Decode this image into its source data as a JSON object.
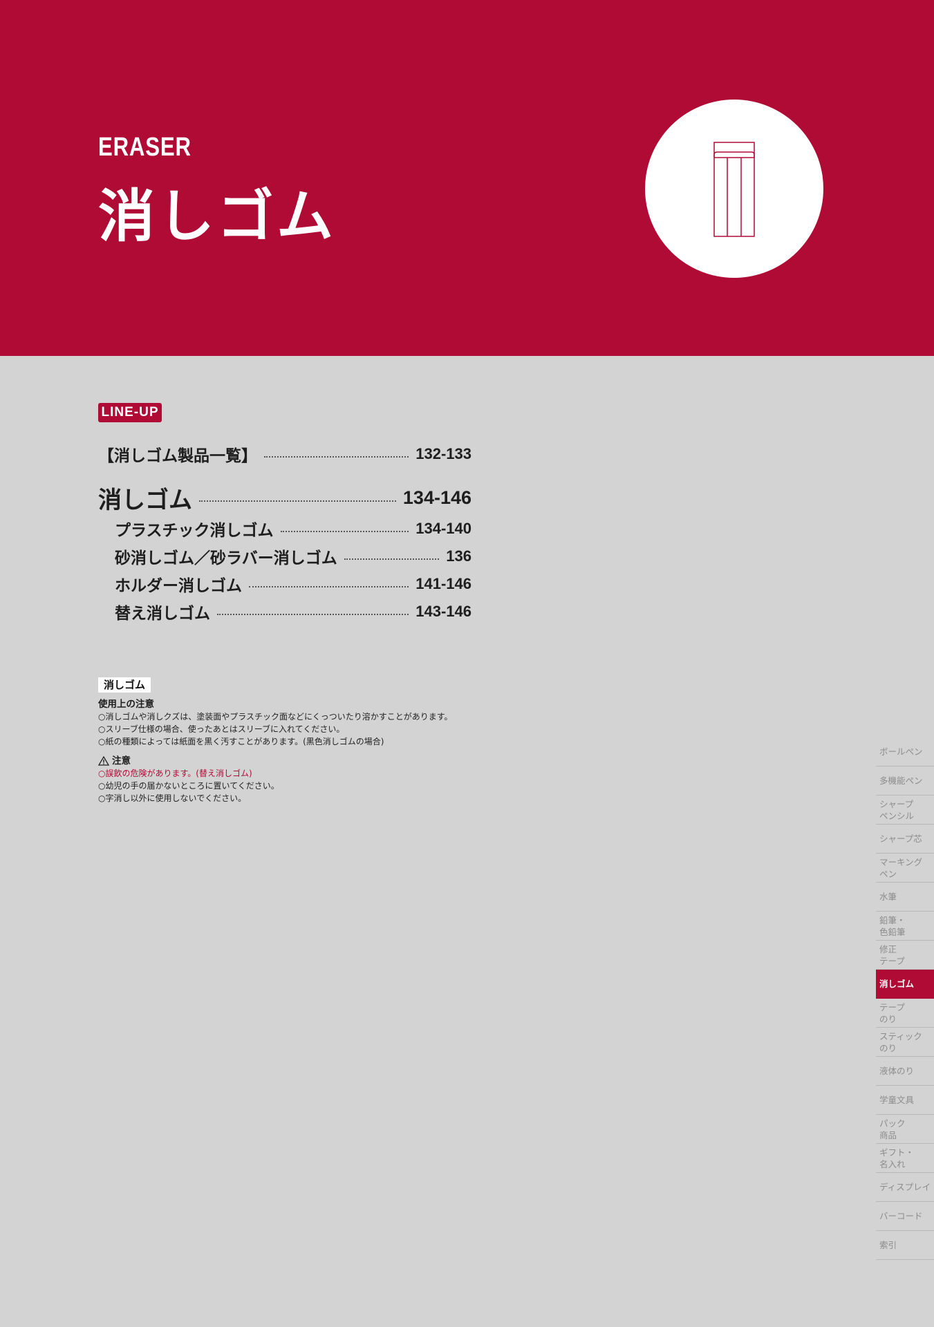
{
  "header": {
    "eng_title": "ERASER",
    "jp_title": "消しゴム",
    "icon": "eraser-icon",
    "bg_color": "#b00b35"
  },
  "lineup": {
    "badge": "LINE-UP",
    "rows": [
      {
        "label": "【消しゴム製品一覧】",
        "pages": "132-133"
      },
      {
        "label": "消しゴム",
        "pages": "134-146"
      },
      {
        "label": "プラスチック消しゴム",
        "pages": "134-140"
      },
      {
        "label": "砂消しゴム／砂ラバー消しゴム",
        "pages": "136"
      },
      {
        "label": "ホルダー消しゴム",
        "pages": "141-146"
      },
      {
        "label": "替え消しゴム",
        "pages": "143-146"
      }
    ]
  },
  "notes": {
    "tag": "消しゴム",
    "usage_heading": "使用上の注意",
    "usage": [
      "○消しゴムや消しクズは、塗装面やプラスチック面などにくっついたり溶かすことがあります。",
      "○スリーブ仕様の場合、使ったあとはスリーブに入れてください。",
      "○紙の種類によっては紙面を黒く汚すことがあります。(黒色消しゴムの場合)"
    ],
    "caution_heading": "注意",
    "caution": [
      "○誤飲の危険があります。(替え消しゴム)",
      "○幼児の手の届かないところに置いてください。",
      "○字消し以外に使用しないでください。"
    ]
  },
  "sidenav": {
    "items": [
      {
        "label": "ボールペン",
        "active": false
      },
      {
        "label": "多機能ペン",
        "active": false
      },
      {
        "label": "シャープ ペンシル",
        "active": false
      },
      {
        "label": "シャープ芯",
        "active": false
      },
      {
        "label": "マーキング ペン",
        "active": false
      },
      {
        "label": "水筆",
        "active": false
      },
      {
        "label": "鉛筆・ 色鉛筆",
        "active": false
      },
      {
        "label": "修正 テープ",
        "active": false
      },
      {
        "label": "消しゴム",
        "active": true
      },
      {
        "label": "テープ のり",
        "active": false
      },
      {
        "label": "スティック のり",
        "active": false
      },
      {
        "label": "液体のり",
        "active": false
      },
      {
        "label": "学童文具",
        "active": false
      },
      {
        "label": "パック 商品",
        "active": false
      },
      {
        "label": "ギフト・ 名入れ",
        "active": false
      },
      {
        "label": "ディスプレイ",
        "active": false
      },
      {
        "label": "バーコード",
        "active": false
      },
      {
        "label": "索引",
        "active": false
      }
    ]
  }
}
